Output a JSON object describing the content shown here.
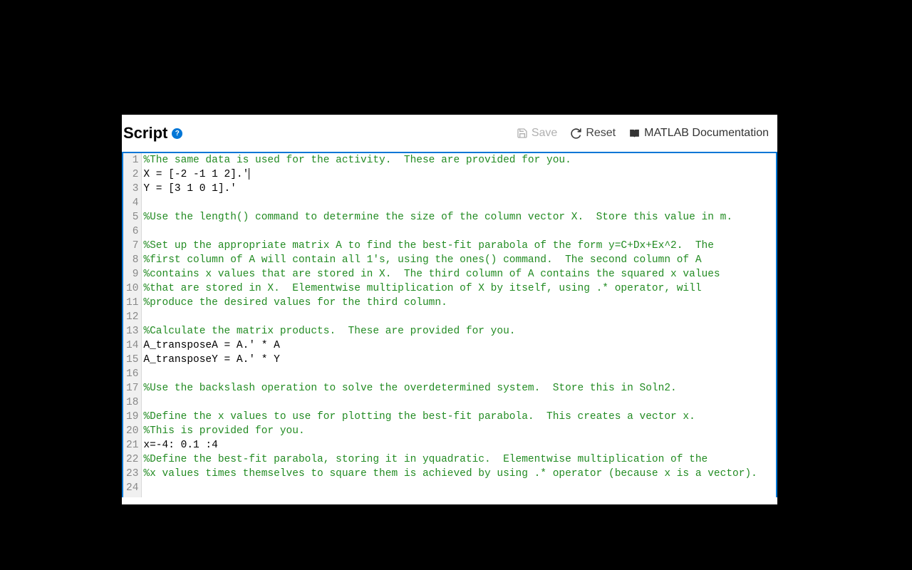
{
  "header": {
    "title": "Script",
    "help": "?"
  },
  "actions": {
    "save": "Save",
    "reset": "Reset",
    "doc": "MATLAB Documentation"
  },
  "lines": [
    {
      "n": "1",
      "type": "cm",
      "t": "%The same data is used for the activity.  These are provided for you."
    },
    {
      "n": "2",
      "type": "code",
      "t": "X = [-2 -1 1 2].'",
      "cursor": true
    },
    {
      "n": "3",
      "type": "code",
      "t": "Y = [3 1 0 1].'"
    },
    {
      "n": "4",
      "type": "code",
      "t": ""
    },
    {
      "n": "5",
      "type": "cm",
      "t": "%Use the length() command to determine the size of the column vector X.  Store this value in m."
    },
    {
      "n": "6",
      "type": "code",
      "t": ""
    },
    {
      "n": "7",
      "type": "cm",
      "t": "%Set up the appropriate matrix A to find the best-fit parabola of the form y=C+Dx+Ex^2.  The "
    },
    {
      "n": "8",
      "type": "cm",
      "t": "%first column of A will contain all 1's, using the ones() command.  The second column of A "
    },
    {
      "n": "9",
      "type": "cm",
      "t": "%contains x values that are stored in X.  The third column of A contains the squared x values "
    },
    {
      "n": "10",
      "type": "cm",
      "t": "%that are stored in X.  Elementwise multiplication of X by itself, using .* operator, will "
    },
    {
      "n": "11",
      "type": "cm",
      "t": "%produce the desired values for the third column."
    },
    {
      "n": "12",
      "type": "code",
      "t": ""
    },
    {
      "n": "13",
      "type": "cm",
      "t": "%Calculate the matrix products.  These are provided for you."
    },
    {
      "n": "14",
      "type": "code",
      "t": "A_transposeA = A.' * A"
    },
    {
      "n": "15",
      "type": "code",
      "t": "A_transposeY = A.' * Y"
    },
    {
      "n": "16",
      "type": "code",
      "t": ""
    },
    {
      "n": "17",
      "type": "cm",
      "t": "%Use the backslash operation to solve the overdetermined system.  Store this in Soln2."
    },
    {
      "n": "18",
      "type": "code",
      "t": ""
    },
    {
      "n": "19",
      "type": "cm",
      "t": "%Define the x values to use for plotting the best-fit parabola.  This creates a vector x. "
    },
    {
      "n": "20",
      "type": "cm",
      "t": "%This is provided for you."
    },
    {
      "n": "21",
      "type": "code",
      "t": "x=-4: 0.1 :4"
    },
    {
      "n": "22",
      "type": "cm",
      "t": "%Define the best-fit parabola, storing it in yquadratic.  Elementwise multiplication of the "
    },
    {
      "n": "23",
      "type": "cm",
      "t": "%x values times themselves to square them is achieved by using .* operator (because x is a vector)."
    },
    {
      "n": "24",
      "type": "code",
      "t": ""
    }
  ]
}
